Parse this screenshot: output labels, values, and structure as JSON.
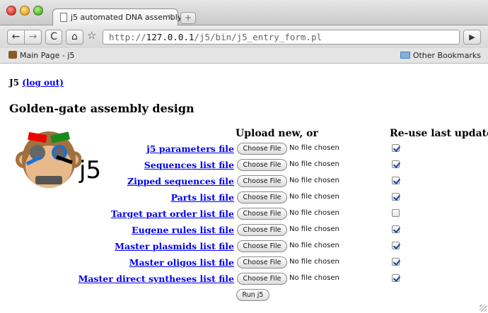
{
  "browser": {
    "tab_title": "j5 automated DNA assembly",
    "tab_close": "×",
    "new_tab": "+",
    "back": "←",
    "forward": "→",
    "reload": "C",
    "home": "⌂",
    "bookmark_star": "☆",
    "url_prefix": "http://",
    "url_host": "127.0.0.1",
    "url_path": "/j5/bin/j5_entry_form.pl",
    "go": "▶",
    "bookmarks": {
      "left": "Main Page - j5",
      "right": "Other Bookmarks"
    }
  },
  "page": {
    "user": "J5",
    "logout": "(log out)",
    "heading": "Golden-gate assembly design",
    "logo_text": "j5",
    "col_upload": "Upload new, or",
    "col_reuse": "Re-use last updated",
    "choose_label": "Choose File",
    "no_file": "No file chosen",
    "run_label": "Run j5",
    "rows": [
      {
        "label": "j5 parameters file",
        "reuse": true
      },
      {
        "label": "Sequences list file",
        "reuse": true
      },
      {
        "label": "Zipped sequences file",
        "reuse": true
      },
      {
        "label": "Parts list file",
        "reuse": true
      },
      {
        "label": "Target part order list file",
        "reuse": false
      },
      {
        "label": "Eugene rules list file",
        "reuse": true
      },
      {
        "label": "Master plasmids list file",
        "reuse": true
      },
      {
        "label": "Master oligos list file",
        "reuse": true
      },
      {
        "label": "Master direct syntheses list file",
        "reuse": true
      }
    ]
  },
  "colors": {
    "link": "#0000ee",
    "checkbox_mark": "#1b3f9e"
  }
}
